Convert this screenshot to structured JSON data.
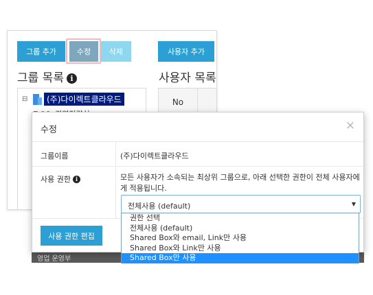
{
  "background": {
    "buttons": {
      "group_add": "그룹 추가",
      "edit": "수정",
      "delete": "삭제",
      "user_add": "사용자 추가"
    },
    "group_list_title": "그룹 목록",
    "user_list_title": "사용자 목록",
    "tree": {
      "root_label": "(주)다이렉트클라우드",
      "child_label": "경영전략실"
    },
    "user_table": {
      "col_no": "No"
    },
    "bottom_row_label": "영업 운영부"
  },
  "modal": {
    "title": "수정",
    "close": "×",
    "rows": {
      "group_name_label": "그룹이름",
      "group_name_value": "(주)다이렉트클라우드",
      "permission_label": "사용 권한",
      "permission_desc": "모든 사용자가 소속되는 최상위 그룹으로, 아래 선택한 권한이 전체 사용자에게 적용됩니다."
    },
    "select": {
      "value": "전체사용 (default)",
      "arrow": "▼"
    },
    "edit_permission_button": "사용 권한 편집"
  },
  "dropdown": {
    "options": [
      "권한 선택",
      "전체사용 (default)",
      "Shared Box와 email, Link만 사용",
      "Shared Box와 Link만 사용",
      "Shared Box만 사용"
    ],
    "highlighted_index": 4
  },
  "icons": {
    "info": "info-icon",
    "building": "building-icon",
    "tree_toggle": "tree-collapse-icon"
  },
  "colors": {
    "primary": "#2ca0d4",
    "edit_button": "#7ea6bd",
    "delete_button": "#8fd6ef",
    "tree_selected": "#001a80",
    "dropdown_highlight": "#1e90ff"
  }
}
